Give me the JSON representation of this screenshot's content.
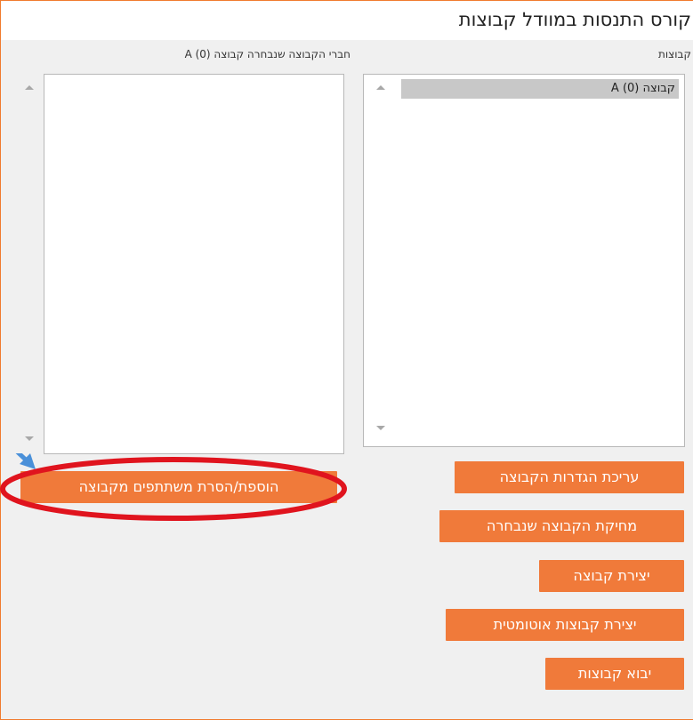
{
  "page": {
    "title": "קורס התנסות במוודל קבוצות"
  },
  "groups_panel": {
    "label": "קבוצות",
    "items": [
      {
        "label": "קבוצה A (0)",
        "selected": true
      }
    ]
  },
  "members_panel": {
    "label": "חברי הקבוצה שנבחרה קבוצה A (0)"
  },
  "buttons": {
    "edit_group": "עריכת הגדרות הקבוצה",
    "delete_group": "מחיקת הקבוצה שנבחרה",
    "create_group": "יצירת קבוצה",
    "auto_create": "יצירת קבוצות אוטומטית",
    "import_groups": "יבוא קבוצות",
    "add_remove_members": "הוספת/הסרת משתתפים מקבוצה"
  },
  "annotation": {
    "highlight_color": "#e0141e",
    "arrow_color": "#4a90d9"
  },
  "colors": {
    "accent": "#f07a3a",
    "border": "#f07b2e",
    "panel_bg": "#f0f0f0",
    "selection": "#c8c8c8"
  }
}
